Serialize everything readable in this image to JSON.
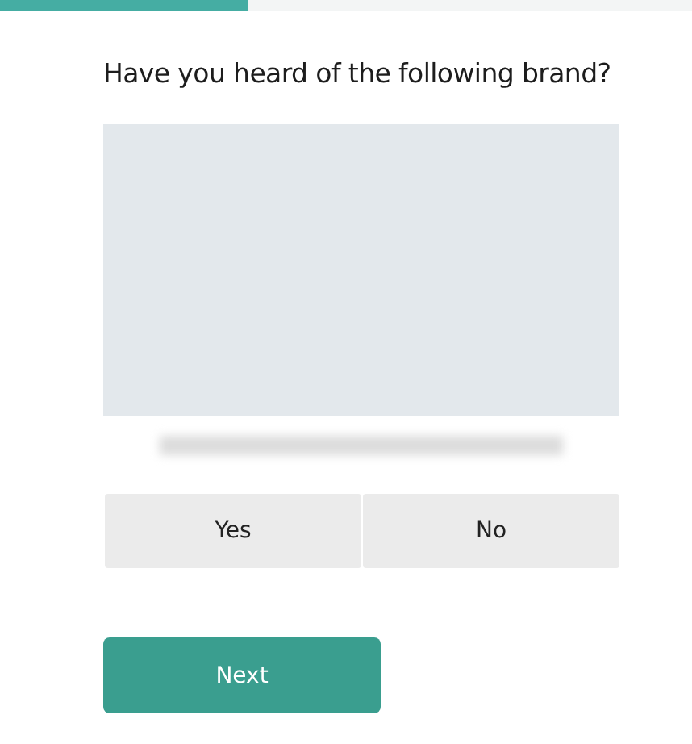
{
  "progress": {
    "level": 0.36
  },
  "question": "Have you heard of the following brand?",
  "brand_image": {
    "kind": "placeholder"
  },
  "answers": [
    {
      "label": "Yes",
      "selected": false
    },
    {
      "label": "No",
      "selected": false
    }
  ],
  "next_button": "Next"
}
